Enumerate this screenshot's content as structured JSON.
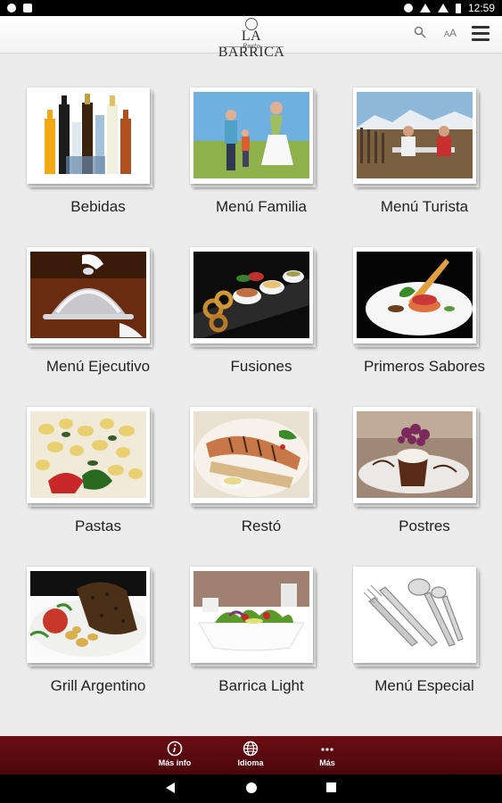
{
  "status_bar": {
    "time": "12:59",
    "icons": [
      "record-icon",
      "sd-card-icon",
      "location-icon",
      "wifi-icon",
      "signal-icon",
      "battery-icon"
    ]
  },
  "app_bar": {
    "logo_text": "LA BARRICA",
    "logo_sub": "Resto",
    "font_size_label_small": "A",
    "font_size_label_large": "A",
    "icons": [
      "search-icon",
      "font-size-icon",
      "hamburger-menu-icon"
    ]
  },
  "menu": {
    "items": [
      {
        "label": "Bebidas",
        "image": "bottles-photo"
      },
      {
        "label": "Menú Familia",
        "image": "family-photo"
      },
      {
        "label": "Menú Turista",
        "image": "tourist-photo"
      },
      {
        "label": "Menú Ejecutivo",
        "image": "cloche-photo"
      },
      {
        "label": "Fusiones",
        "image": "appetizers-photo"
      },
      {
        "label": "Primeros Sabores",
        "image": "starter-plate-photo"
      },
      {
        "label": "Pastas",
        "image": "pasta-photo"
      },
      {
        "label": "Restó",
        "image": "fish-plate-photo"
      },
      {
        "label": "Postres",
        "image": "dessert-photo"
      },
      {
        "label": "Grill Argentino",
        "image": "grilled-meat-photo"
      },
      {
        "label": "Barrica Light",
        "image": "salad-photo"
      },
      {
        "label": "Menú Especial",
        "image": "cutlery-photo"
      }
    ]
  },
  "bottom_bar": {
    "items": [
      {
        "label": "Más info",
        "icon": "info-icon"
      },
      {
        "label": "Idioma",
        "icon": "globe-icon"
      },
      {
        "label": "Más",
        "icon": "more-dots-icon"
      }
    ],
    "background": "#5a0a0f"
  },
  "nav_bar": {
    "icons": [
      "back-icon",
      "home-icon",
      "recents-icon"
    ]
  }
}
